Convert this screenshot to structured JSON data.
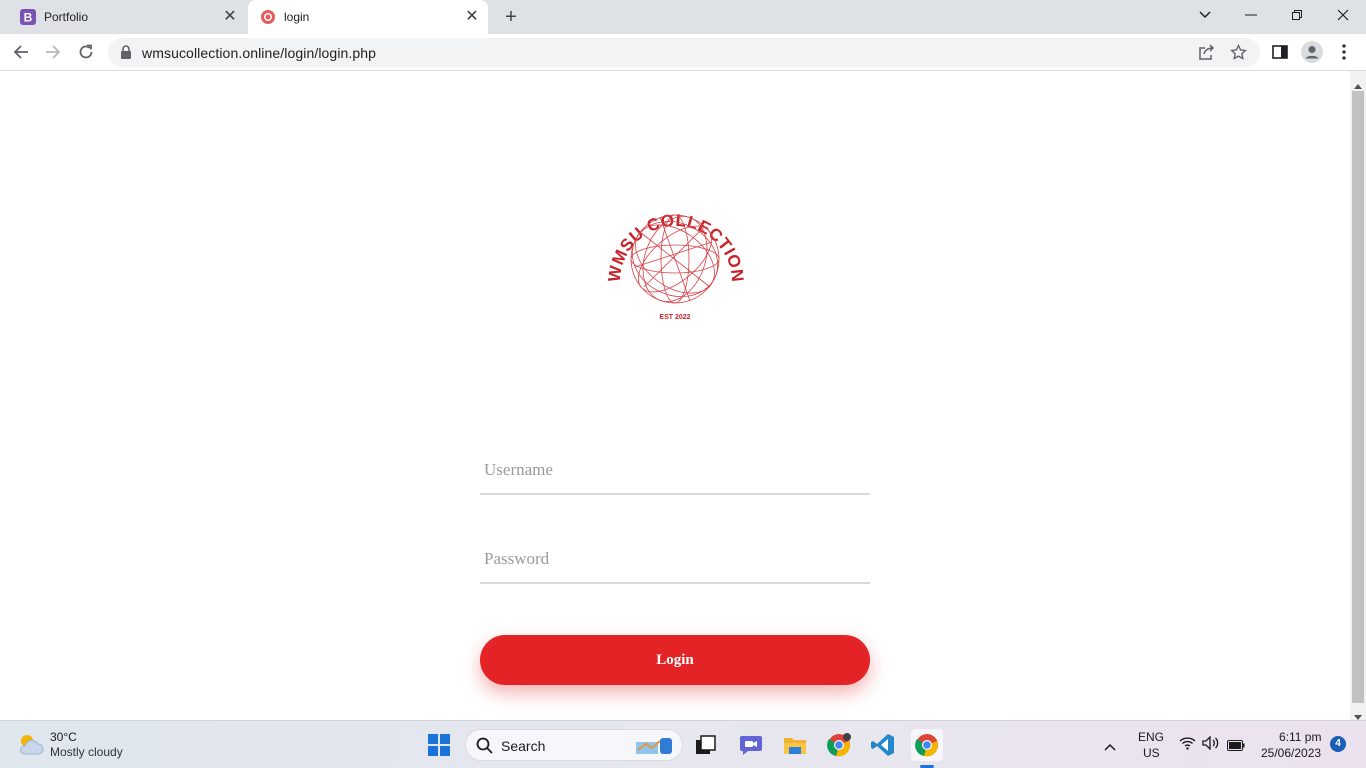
{
  "browser": {
    "tabs": [
      {
        "title": "Portfolio",
        "favicon": "bootstrap-icon"
      },
      {
        "title": "login",
        "favicon": "wmsu-logo-icon",
        "active": true
      }
    ],
    "url": "wmsucollection.online/login/login.php"
  },
  "page": {
    "logo": {
      "arc_text": "WMSU COLLECTION",
      "subtext": "EST 2022"
    },
    "username_placeholder": "Username",
    "password_placeholder": "Password",
    "login_label": "Login"
  },
  "taskbar": {
    "weather": {
      "temp": "30°C",
      "condition": "Mostly cloudy"
    },
    "search_label": "Search",
    "lang": {
      "line1": "ENG",
      "line2": "US"
    },
    "time": "6:11 pm",
    "date": "25/06/2023",
    "notification_count": "4"
  },
  "colors": {
    "accent": "#e32326",
    "logo": "#c8232a"
  }
}
